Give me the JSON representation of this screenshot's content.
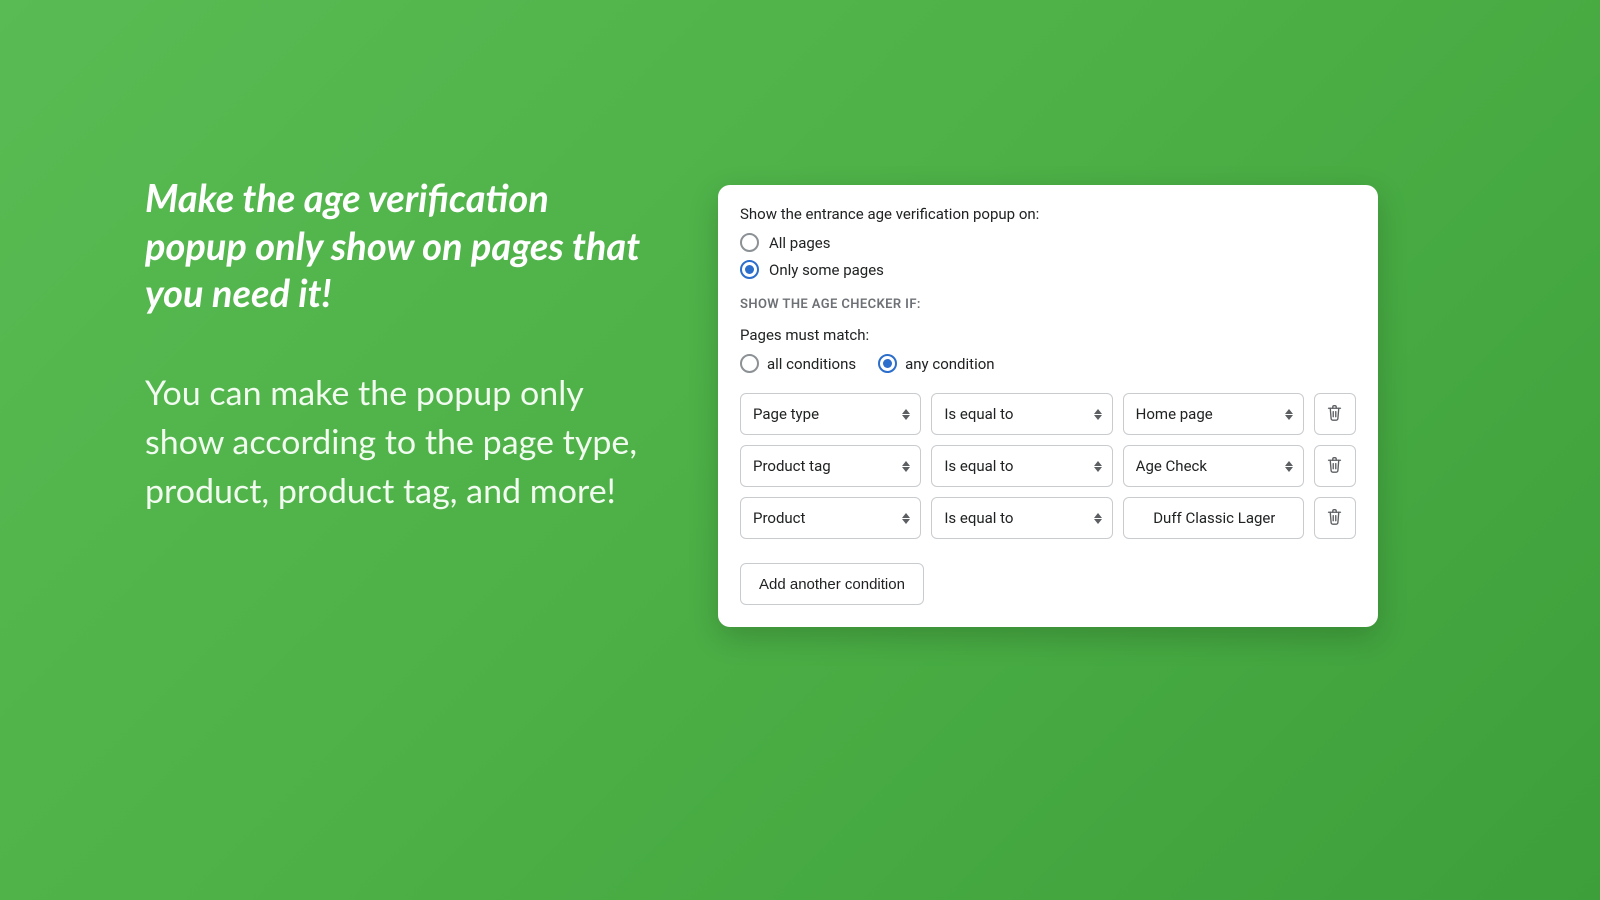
{
  "promo": {
    "headline": "Make the age verification popup only show on pages that you need it!",
    "subtext": "You can make the popup only show according to the page type, product, product tag, and more!"
  },
  "panel": {
    "show_on_label": "Show the entrance age verification popup on:",
    "show_on_options": {
      "all": "All pages",
      "some": "Only some pages"
    },
    "section_heading": "Show the age checker if:",
    "match_label": "Pages must match:",
    "match_options": {
      "all": "all conditions",
      "any": "any condition"
    },
    "conditions": [
      {
        "field": "Page type",
        "operator": "Is equal to",
        "value": "Home page",
        "value_is_select": true
      },
      {
        "field": "Product tag",
        "operator": "Is equal to",
        "value": "Age Check",
        "value_is_select": true
      },
      {
        "field": "Product",
        "operator": "Is equal to",
        "value": "Duff Classic Lager",
        "value_is_select": false
      }
    ],
    "add_button": "Add another condition"
  }
}
